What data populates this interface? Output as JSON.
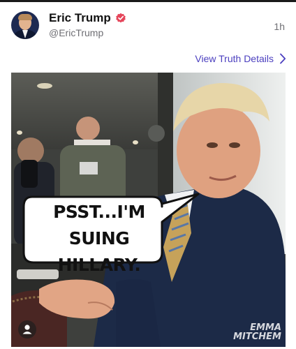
{
  "header": {
    "display_name": "Eric Trump",
    "handle": "@EricTrump",
    "timestamp": "1h",
    "verified_icon": "verified-badge-icon"
  },
  "actions": {
    "view_details_label": "View Truth Details",
    "chevron_icon": "chevron-right-icon"
  },
  "media": {
    "speech_bubble": {
      "line1": "PSST...I'M",
      "line2": "SUING HILLARY."
    },
    "watermark": {
      "line1": "EMMA",
      "line2": "MITCHEM"
    },
    "tag_icon": "person-icon"
  },
  "colors": {
    "accent": "#4b3fbf",
    "verified_badge": "#e5455a"
  }
}
